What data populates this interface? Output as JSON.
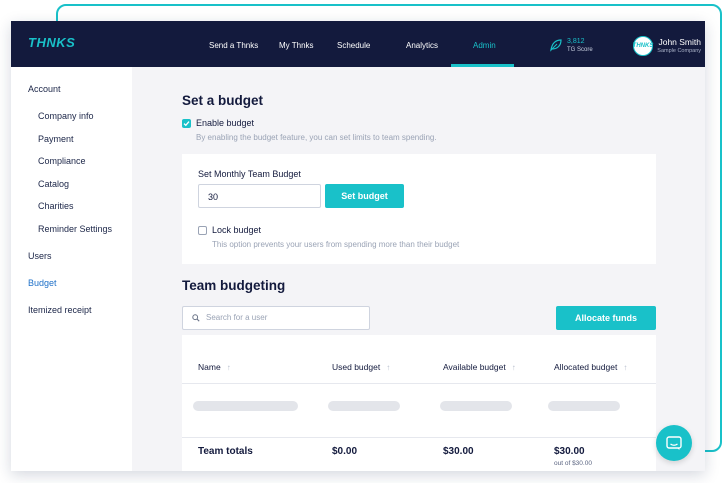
{
  "header": {
    "logo": "THNKS",
    "nav": [
      {
        "label": "Send a Thnks"
      },
      {
        "label": "My Thnks"
      },
      {
        "label": "Schedule"
      },
      {
        "label": "Analytics"
      },
      {
        "label": "Admin"
      }
    ],
    "score": {
      "value": "3,812",
      "label": "TG Score"
    },
    "avatar_text": "THNKS",
    "user": {
      "name": "John Smith",
      "company": "Sample Company"
    }
  },
  "sidebar": {
    "items": [
      {
        "label": "Account"
      },
      {
        "label": "Company info"
      },
      {
        "label": "Payment"
      },
      {
        "label": "Compliance"
      },
      {
        "label": "Catalog"
      },
      {
        "label": "Charities"
      },
      {
        "label": "Reminder Settings"
      },
      {
        "label": "Users"
      },
      {
        "label": "Budget"
      },
      {
        "label": "Itemized receipt"
      }
    ]
  },
  "budget": {
    "title": "Set a budget",
    "enable_label": "Enable budget",
    "enable_checked": true,
    "enable_hint": "By enabling the budget feature, you can set limits to team spending.",
    "monthly_label": "Set Monthly Team Budget",
    "monthly_value": "30",
    "set_button": "Set budget",
    "lock_label": "Lock budget",
    "lock_checked": false,
    "lock_hint": "This option prevents your users from spending more than their budget"
  },
  "team": {
    "title": "Team budgeting",
    "search_placeholder": "Search for a user",
    "allocate_button": "Allocate funds",
    "columns": [
      "Name",
      "Used budget",
      "Available budget",
      "Allocated budget"
    ],
    "sort_arrow": "↑",
    "totals": {
      "label": "Team totals",
      "used": "$0.00",
      "available": "$30.00",
      "allocated": "$30.00",
      "allocated_sub": "out of $30.00"
    }
  },
  "colors": {
    "accent": "#19c1c9",
    "navy": "#131a3d",
    "active_link": "#1e70c8"
  }
}
